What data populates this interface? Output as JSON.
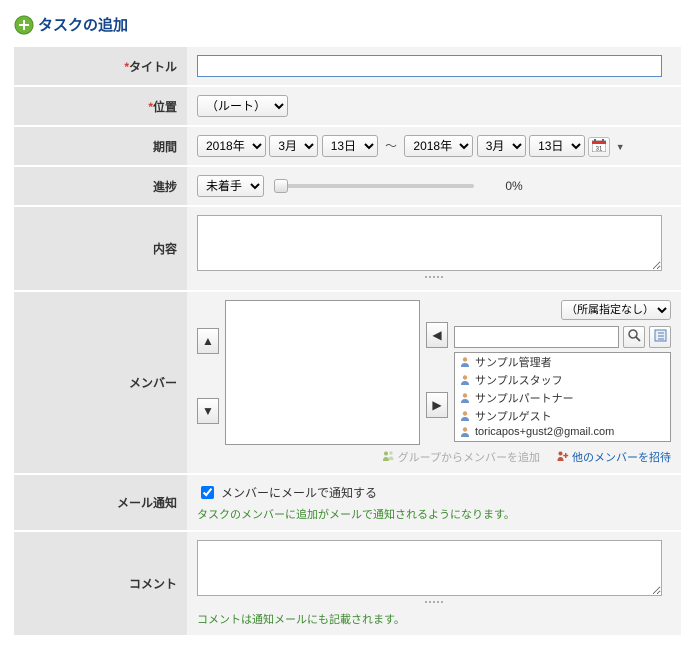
{
  "header": {
    "title": "タスクの追加"
  },
  "labels": {
    "title": "タイトル",
    "position": "位置",
    "period": "期間",
    "progress": "進捗",
    "content": "内容",
    "member": "メンバー",
    "mailNotify": "メール通知",
    "comment": "コメント"
  },
  "title_field": {
    "value": ""
  },
  "position": {
    "selected": "（ルート）"
  },
  "period": {
    "start": {
      "year": "2018年",
      "month": "3月",
      "day": "13日"
    },
    "end": {
      "year": "2018年",
      "month": "3月",
      "day": "13日"
    },
    "separator": "〜"
  },
  "progress": {
    "status": "未着手",
    "percent_text": "0%"
  },
  "content": {
    "value": ""
  },
  "member": {
    "filter_selected": "（所属指定なし）",
    "search_value": "",
    "candidates": [
      "サンプル管理者",
      "サンプルスタッフ",
      "サンプルパートナー",
      "サンプルゲスト",
      "toricapos+gust2@gmail.com"
    ],
    "group_add_label": "グループからメンバーを追加",
    "invite_label": "他のメンバーを招待"
  },
  "mail": {
    "checkbox_label": "メンバーにメールで通知する",
    "checked": true,
    "note": "タスクのメンバーに追加がメールで通知されるようになります。"
  },
  "comment": {
    "value": "",
    "note": "コメントは通知メールにも記載されます。"
  },
  "icons": {
    "plus": "plus-circle-icon",
    "person": "person-icon",
    "search": "search-icon",
    "book": "address-book-icon",
    "calendar": "calendar-icon",
    "people_add": "people-plus-icon"
  }
}
